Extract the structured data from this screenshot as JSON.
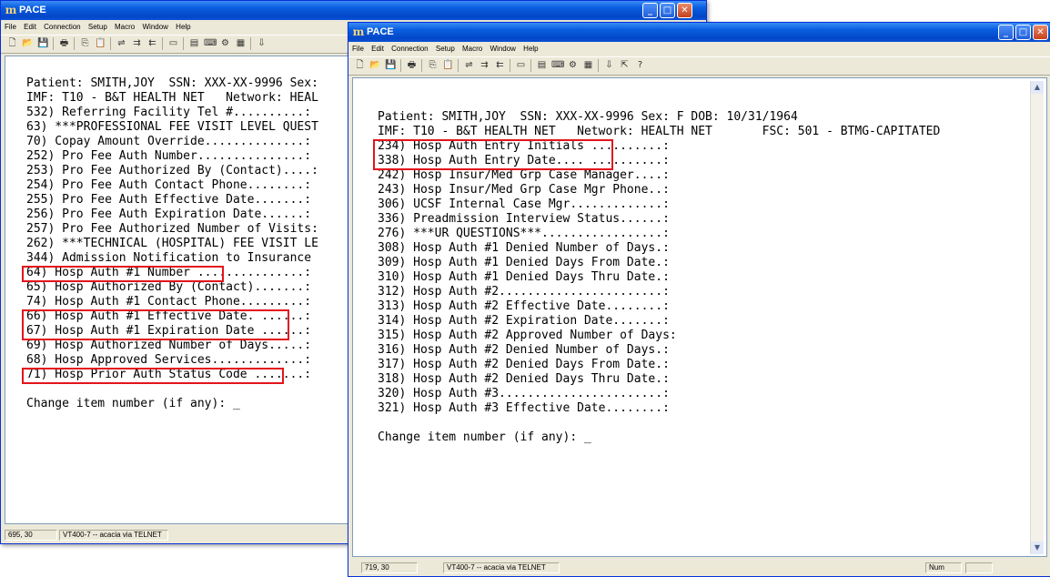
{
  "windows": {
    "back": {
      "title": "PACE",
      "menu": [
        "File",
        "Edit",
        "Connection",
        "Setup",
        "Macro",
        "Window",
        "Help"
      ],
      "lines": [
        "Patient: SMITH,JOY  SSN: XXX-XX-9996 Sex:",
        "IMF: T10 - B&T HEALTH NET   Network: HEAL",
        "532) Referring Facility Tel #..........:",
        "63) ***PROFESSIONAL FEE VISIT LEVEL QUEST",
        "70) Copay Amount Override..............:",
        "252) Pro Fee Auth Number...............:",
        "253) Pro Fee Authorized By (Contact)....:",
        "254) Pro Fee Auth Contact Phone........:",
        "255) Pro Fee Auth Effective Date.......:",
        "256) Pro Fee Auth Expiration Date......:",
        "257) Pro Fee Authorized Number of Visits:",
        "262) ***TECHNICAL (HOSPITAL) FEE VISIT LE",
        "344) Admission Notification to Insurance",
        "64) Hosp Auth #1 Number ...............:",
        "65) Hosp Authorized By (Contact).......:",
        "74) Hosp Auth #1 Contact Phone.........:",
        "66) Hosp Auth #1 Effective Date. ......:",
        "67) Hosp Auth #1 Expiration Date ......:",
        "69) Hosp Authorized Number of Days.....:",
        "68) Hosp Approved Services.............:",
        "71) Hosp Prior Auth Status Code .......:",
        "",
        "Change item number (if any): _"
      ],
      "status": {
        "position": "695, 30",
        "terminal": "VT400-7 -- acacia via TELNET"
      }
    },
    "front": {
      "title": "PACE",
      "menu": [
        "File",
        "Edit",
        "Connection",
        "Setup",
        "Macro",
        "Window",
        "Help"
      ],
      "lines": [
        "Patient: SMITH,JOY  SSN: XXX-XX-9996 Sex: F DOB: 10/31/1964",
        "IMF: T10 - B&T HEALTH NET   Network: HEALTH NET       FSC: 501 - BTMG-CAPITATED",
        "234) Hosp Auth Entry Initials ..........:",
        "338) Hosp Auth Entry Date.... ..........:",
        "242) Hosp Insur/Med Grp Case Manager....:",
        "243) Hosp Insur/Med Grp Case Mgr Phone..:",
        "306) UCSF Internal Case Mgr.............:",
        "336) Preadmission Interview Status......:",
        "276) ***UR QUESTIONS***.................:",
        "308) Hosp Auth #1 Denied Number of Days.:",
        "309) Hosp Auth #1 Denied Days From Date.:",
        "310) Hosp Auth #1 Denied Days Thru Date.:",
        "312) Hosp Auth #2.......................:",
        "313) Hosp Auth #2 Effective Date........:",
        "314) Hosp Auth #2 Expiration Date.......:",
        "315) Hosp Auth #2 Approved Number of Days:",
        "316) Hosp Auth #2 Denied Number of Days.:",
        "317) Hosp Auth #2 Denied Days From Date.:",
        "318) Hosp Auth #2 Denied Days Thru Date.:",
        "320) Hosp Auth #3.......................:",
        "321) Hosp Auth #3 Effective Date........:",
        "",
        "Change item number (if any): _"
      ],
      "status": {
        "position": "719, 30",
        "terminal": "VT400-7 -- acacia via TELNET",
        "num": "Num"
      }
    }
  },
  "colors": {
    "highlight": "#e3141b",
    "titlebar": "#0a5fe0"
  }
}
